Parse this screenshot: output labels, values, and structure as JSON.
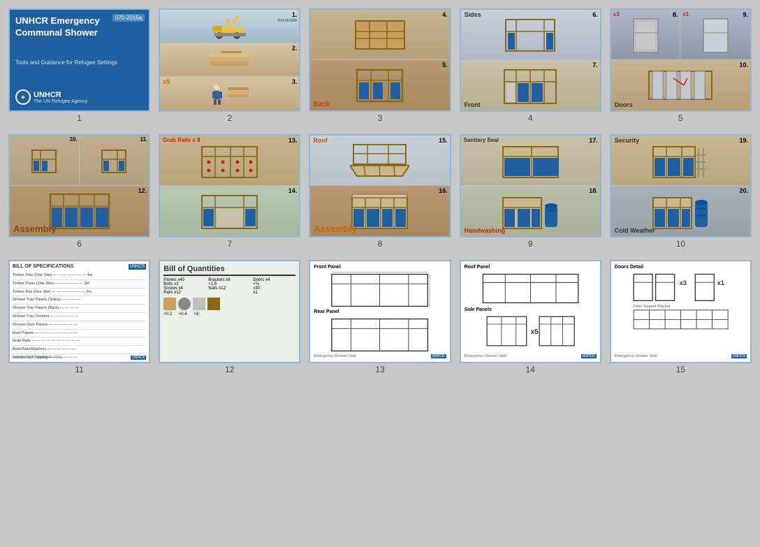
{
  "title": "UNHCR Emergency Communal Shower",
  "subtitle": "Tools and Guidance for Refugee Settings",
  "badge": "070-2015a",
  "logo": "UNHCR",
  "logo_sub": "The UN Refugee Agency",
  "pages": [
    {
      "num": "1",
      "label": "1",
      "type": "cover"
    },
    {
      "num": "2",
      "label": "2",
      "type": "multi3",
      "steps": [
        "1.",
        "2.",
        "3."
      ],
      "note": "x5"
    },
    {
      "num": "3",
      "label": "3",
      "type": "multi2",
      "steps": [
        "4.",
        "5."
      ],
      "sublabels": [
        "",
        "Back"
      ]
    },
    {
      "num": "4",
      "label": "4",
      "type": "multi2",
      "steps": [
        "6.",
        "7."
      ],
      "sublabels": [
        "Sides",
        "Front"
      ]
    },
    {
      "num": "5",
      "label": "5",
      "type": "multi3h",
      "steps": [
        "8.",
        "9.",
        "10."
      ],
      "sublabels": [
        "",
        "",
        "Doors"
      ],
      "note1": "x3",
      "note2": "x1"
    },
    {
      "num": "6",
      "label": "6",
      "type": "multi2",
      "steps": [
        "10.",
        "11.",
        "12."
      ],
      "sublabels": [
        "",
        "",
        "Assembly"
      ]
    },
    {
      "num": "7",
      "label": "7",
      "type": "multi2",
      "steps": [
        "13.",
        "14."
      ],
      "sublabels": [
        "Grab Rails x 8",
        ""
      ]
    },
    {
      "num": "8",
      "label": "8",
      "type": "multi2",
      "steps": [
        "15.",
        "16."
      ],
      "sublabels": [
        "Roof",
        "Assembly"
      ]
    },
    {
      "num": "9",
      "label": "9",
      "type": "multi2",
      "steps": [
        "17.",
        "18."
      ],
      "sublabels": [
        "Sanitary Seal",
        "Handwashing"
      ]
    },
    {
      "num": "10",
      "label": "10",
      "type": "multi2",
      "steps": [
        "19.",
        "20."
      ],
      "sublabels": [
        "Security",
        "Cold Weather"
      ]
    },
    {
      "num": "11",
      "label": "11",
      "type": "specs"
    },
    {
      "num": "12",
      "label": "12",
      "type": "boq"
    },
    {
      "num": "13",
      "label": "13",
      "type": "drawing",
      "title": "Front Panel / Rear Panel"
    },
    {
      "num": "14",
      "label": "14",
      "type": "drawing2",
      "title": "Roof Panel / Side Panels"
    },
    {
      "num": "15",
      "label": "15",
      "type": "drawing3",
      "title": "Doors Detail"
    }
  ],
  "colors": {
    "accent": "#2060a0",
    "sandy": "#d4b87a",
    "frame": "#8b6914",
    "red_label": "#cc2200",
    "orange_label": "#dd5500"
  }
}
